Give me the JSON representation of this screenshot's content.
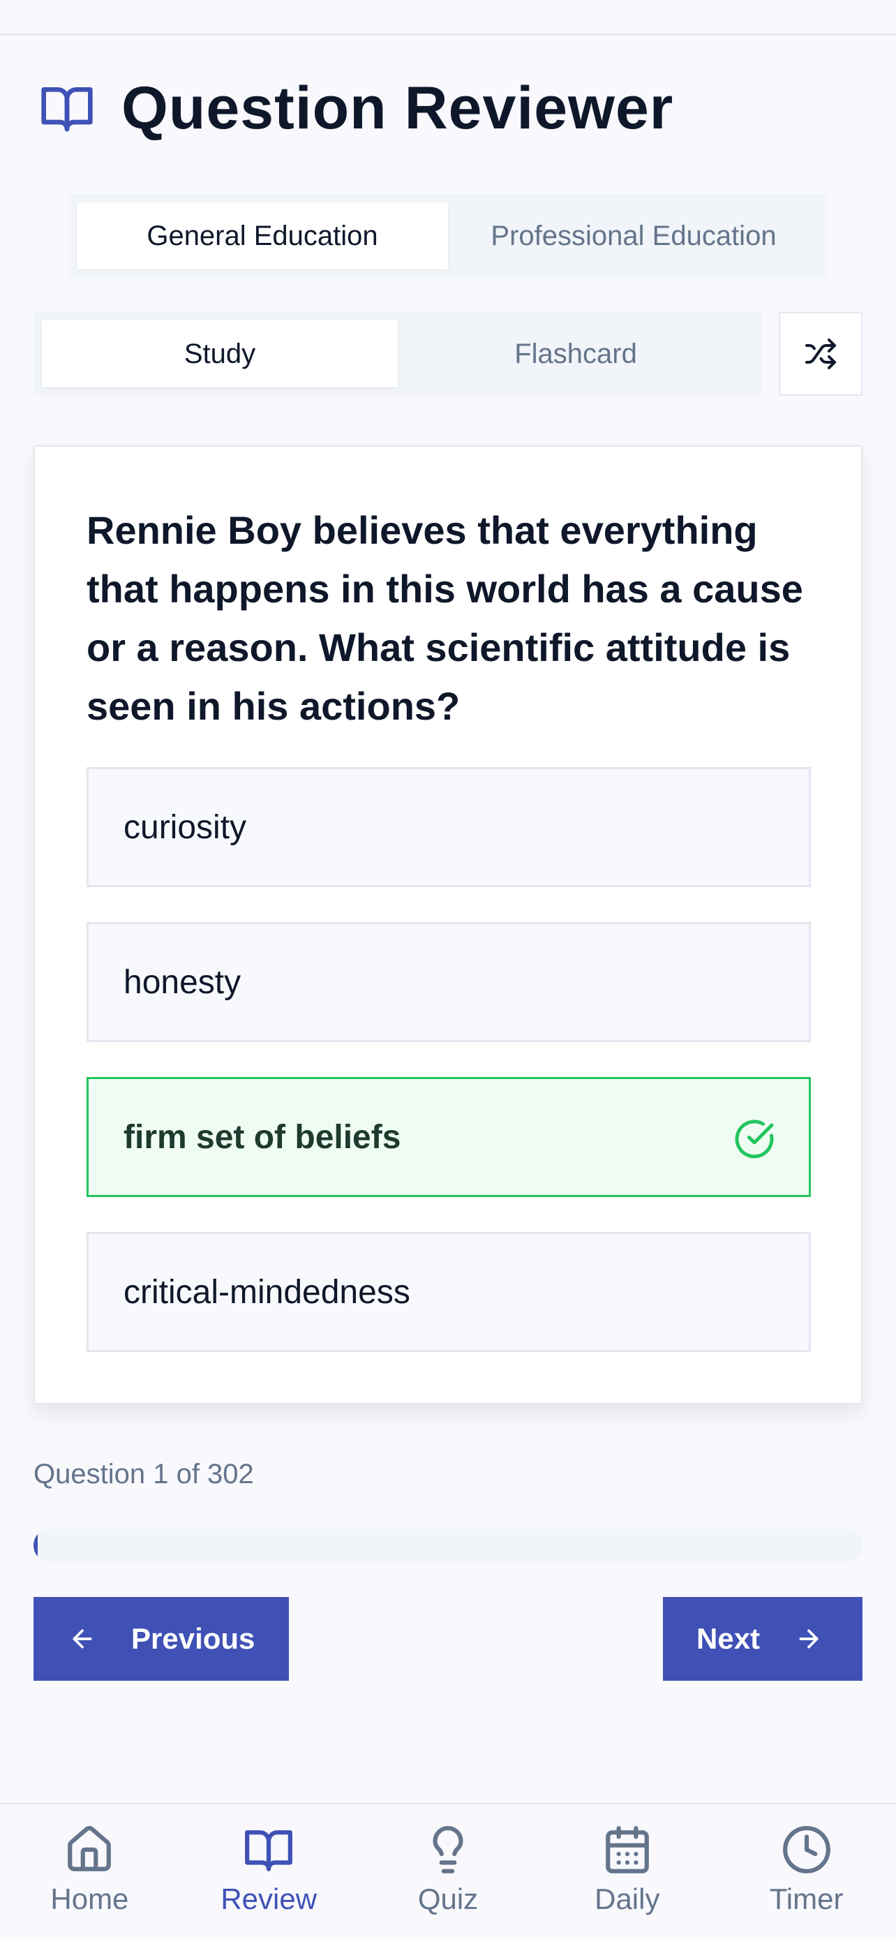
{
  "header": {
    "title": "Question Reviewer",
    "icon": "book-open-icon"
  },
  "category_tabs": [
    {
      "label": "General Education",
      "active": true
    },
    {
      "label": "Professional Education",
      "active": false
    }
  ],
  "mode_tabs": [
    {
      "label": "Study",
      "active": true
    },
    {
      "label": "Flashcard",
      "active": false
    }
  ],
  "shuffle": {
    "icon": "shuffle-icon"
  },
  "question": {
    "text": "Rennie Boy believes that everything that happens in this world has a cause or a reason. What scientific attitude is seen in his actions?",
    "choices": [
      {
        "label": "curiosity",
        "correct": false
      },
      {
        "label": "honesty",
        "correct": false
      },
      {
        "label": "firm set of beliefs",
        "correct": true
      },
      {
        "label": "critical-mindedness",
        "correct": false
      }
    ]
  },
  "progress": {
    "label": "Question 1 of 302",
    "current": 1,
    "total": 302
  },
  "nav": {
    "previous_label": "Previous",
    "next_label": "Next"
  },
  "tabbar": [
    {
      "label": "Home",
      "icon": "home-icon",
      "active": false
    },
    {
      "label": "Review",
      "icon": "book-open-icon",
      "active": true
    },
    {
      "label": "Quiz",
      "icon": "lightbulb-icon",
      "active": false
    },
    {
      "label": "Daily",
      "icon": "calendar-icon",
      "active": false
    },
    {
      "label": "Timer",
      "icon": "clock-icon",
      "active": false
    }
  ],
  "colors": {
    "accent": "#3f51b5",
    "correct": "#22c55e",
    "correct_bg": "#effcf3"
  }
}
